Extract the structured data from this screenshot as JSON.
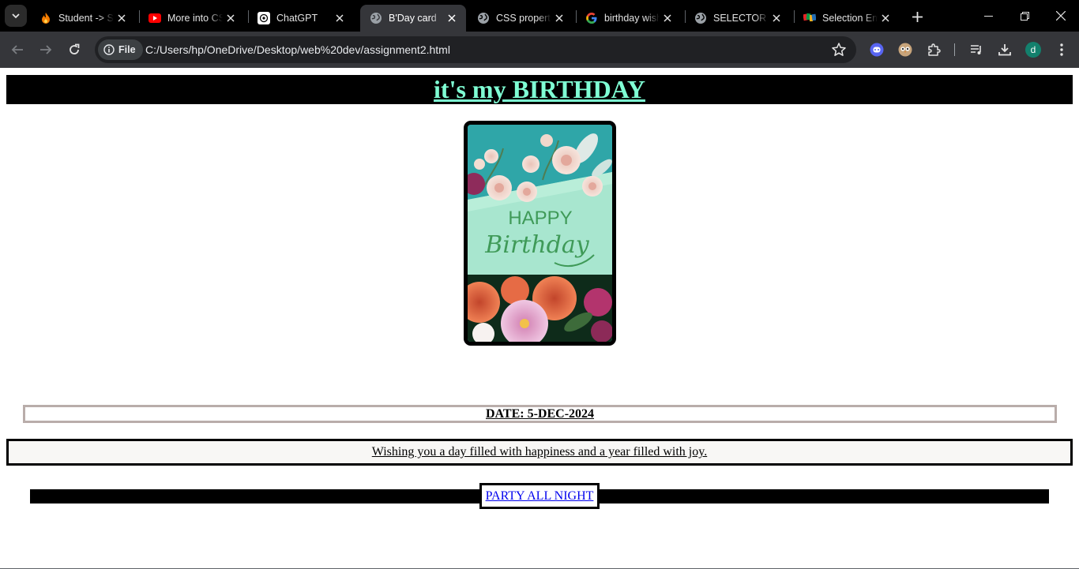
{
  "browser": {
    "tabs": [
      {
        "title": "Student -> Sem",
        "icon": "fire-icon"
      },
      {
        "title": "More into CSS",
        "icon": "youtube-icon"
      },
      {
        "title": "ChatGPT",
        "icon": "chatgpt-icon"
      },
      {
        "title": "B'Day card",
        "icon": "globe-icon",
        "active": true
      },
      {
        "title": "CSS properties",
        "icon": "globe-icon"
      },
      {
        "title": "birthday wishes",
        "icon": "google-icon"
      },
      {
        "title": "SELECTOR",
        "icon": "globe-icon"
      },
      {
        "title": "Selection Emp",
        "icon": "zoho-icon"
      }
    ],
    "address": {
      "chip_label": "File",
      "url": "C:/Users/hp/OneDrive/Desktop/web%20dev/assignment2.html"
    },
    "profile_initial": "d"
  },
  "page": {
    "heading": "it's my BIRTHDAY",
    "card_image_text": {
      "line1": "HAPPY",
      "line2": "Birthday"
    },
    "date": "DATE: 5-DEC-2024",
    "wish": "Wishing you a day filled with happiness and a year filled with joy.",
    "party_link": "PARTY ALL NIGHT"
  },
  "colors": {
    "heading_text": "#7fffd4",
    "heading_bg": "#000000",
    "date_border": "#b9adaa",
    "link": "#0000ee"
  }
}
